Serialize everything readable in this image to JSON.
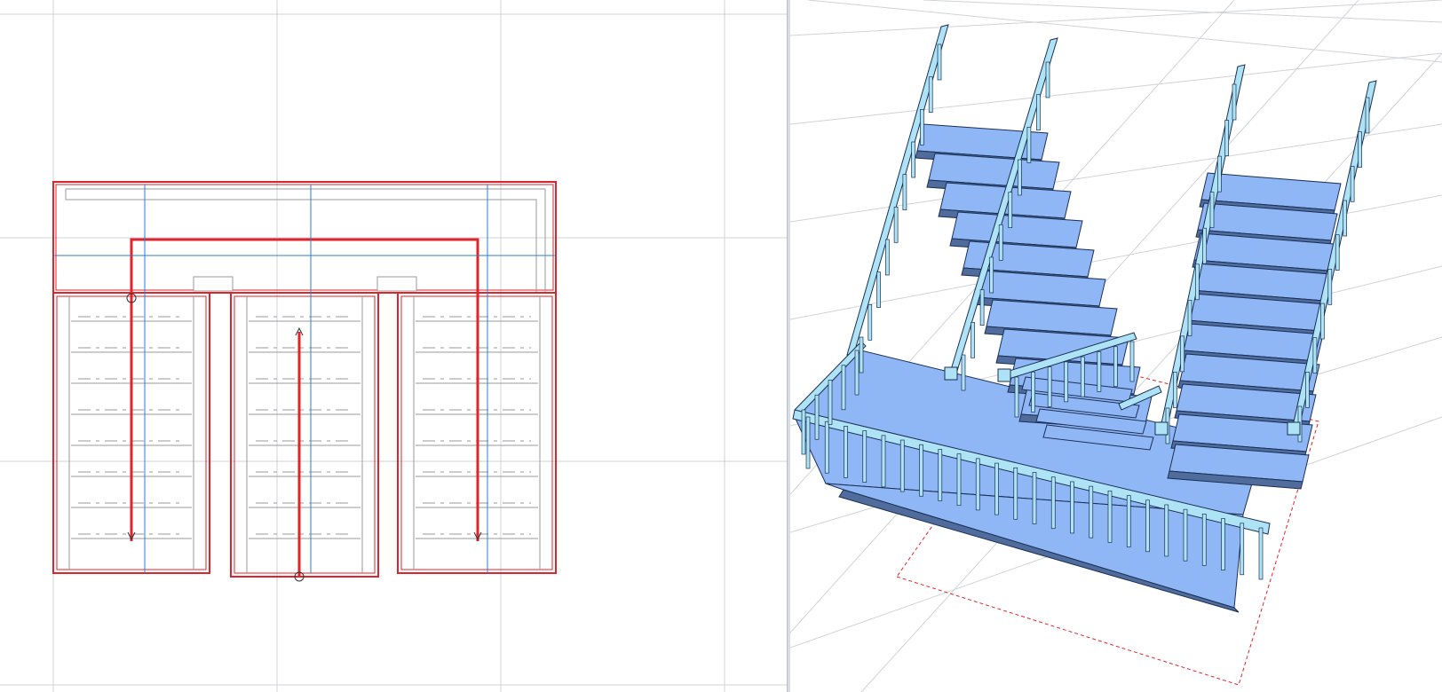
{
  "window": {
    "layout": "split-view",
    "left_view": "2d-floor-plan",
    "right_view": "3d-perspective"
  },
  "colors": {
    "grid": "#cfd3d8",
    "stair_outline": "#e0242b",
    "axis_line": "#2a7fd4",
    "tread_line": "#9a9a9a",
    "stair_face": "#8fb6f5",
    "stair_face_dark": "#4f6c9c",
    "handrail": "#aee3f5",
    "dashed_boundary": "#e0242b"
  },
  "icons": {
    "plan_hotspots": "circle-marker-icon",
    "walk_arrows": "arrow-icon"
  },
  "plan": {
    "flights": 3,
    "treads_per_flight": 8
  }
}
